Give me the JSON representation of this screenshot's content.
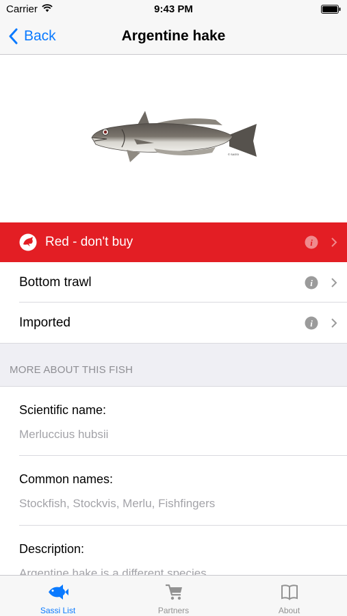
{
  "status_bar": {
    "carrier": "Carrier",
    "time": "9:43 PM"
  },
  "nav": {
    "back_label": "Back",
    "title": "Argentine hake"
  },
  "fish_image": {
    "credit": "© SASSI"
  },
  "rating": {
    "label": "Red - don't buy",
    "color": "#e31e24"
  },
  "method": {
    "label": "Bottom trawl"
  },
  "origin": {
    "label": "Imported"
  },
  "section": {
    "header": "MORE ABOUT THIS FISH"
  },
  "details": {
    "scientific_name_title": "Scientific name:",
    "scientific_name_value": "Merluccius hubsii",
    "common_names_title": "Common names:",
    "common_names_value": "Stockfish, Stockvis, Merlu, Fishfingers",
    "description_title": "Description:",
    "description_value": "Argentine hake is a different species"
  },
  "tabs": [
    {
      "label": "Sassi List",
      "icon": "fish-icon",
      "active": true
    },
    {
      "label": "Partners",
      "icon": "cart-icon",
      "active": false
    },
    {
      "label": "About",
      "icon": "book-icon",
      "active": false
    }
  ],
  "colors": {
    "accent": "#0a7aff",
    "red_rating": "#e31e24",
    "inactive_tab": "#929292"
  }
}
